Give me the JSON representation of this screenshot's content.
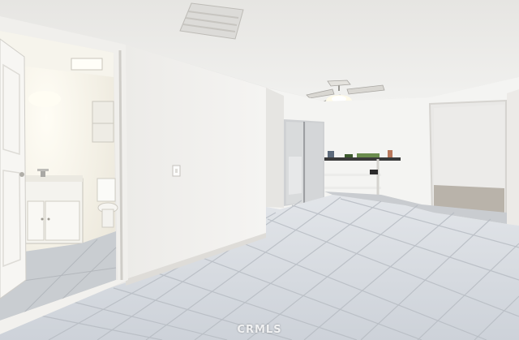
{
  "photo": {
    "description_tags": [
      "interior",
      "empty-room",
      "tile-floor",
      "bathroom-doorway",
      "ceiling-fan",
      "wall-shelves",
      "mirrored-closet"
    ],
    "watermark": "CRMLS"
  },
  "colors": {
    "ceiling": "#eeeeec",
    "wall_left": "#f1f0ee",
    "wall_back": "#f3f3f1",
    "floor": "#d9dde2",
    "grout": "#b9bec5",
    "bath_wall": "#f3f1ea",
    "shelf": "#3a3a3a"
  }
}
